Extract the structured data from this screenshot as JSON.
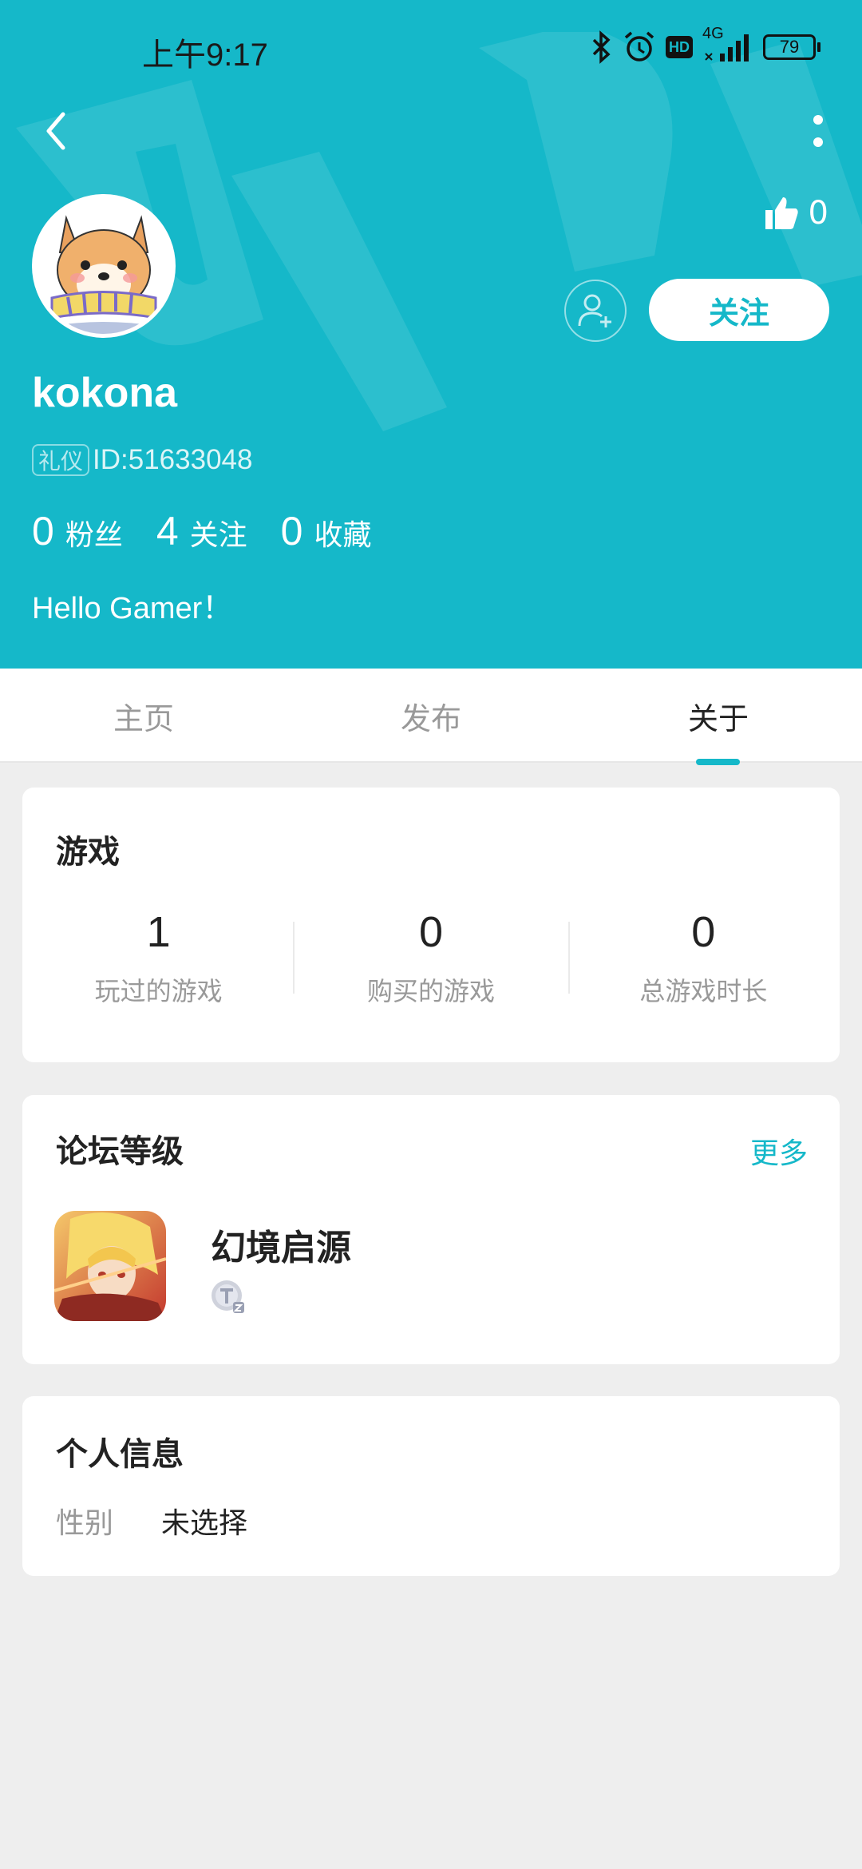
{
  "status_bar": {
    "time": "上午9:17",
    "network": "4G",
    "hd": "HD",
    "battery": "79"
  },
  "header": {
    "likes_count": "0",
    "follow_label": "关注",
    "username": "kokona",
    "tag": "礼仪",
    "user_id": "ID:51633048",
    "stats": [
      {
        "num": "0",
        "label": "粉丝"
      },
      {
        "num": "4",
        "label": "关注"
      },
      {
        "num": "0",
        "label": "收藏"
      }
    ],
    "bio": "Hello Gamer！"
  },
  "tabs": [
    "主页",
    "发布",
    "关于"
  ],
  "games_card": {
    "title": "游戏",
    "stats": [
      {
        "num": "1",
        "label": "玩过的游戏"
      },
      {
        "num": "0",
        "label": "购买的游戏"
      },
      {
        "num": "0",
        "label": "总游戏时长"
      }
    ]
  },
  "forum_card": {
    "title": "论坛等级",
    "more": "更多",
    "item_name": "幻境启源"
  },
  "info_card": {
    "title": "个人信息",
    "gender_key": "性别",
    "gender_value": "未选择"
  },
  "colors": {
    "accent": "#15b8c9",
    "background": "#eeeeee"
  }
}
